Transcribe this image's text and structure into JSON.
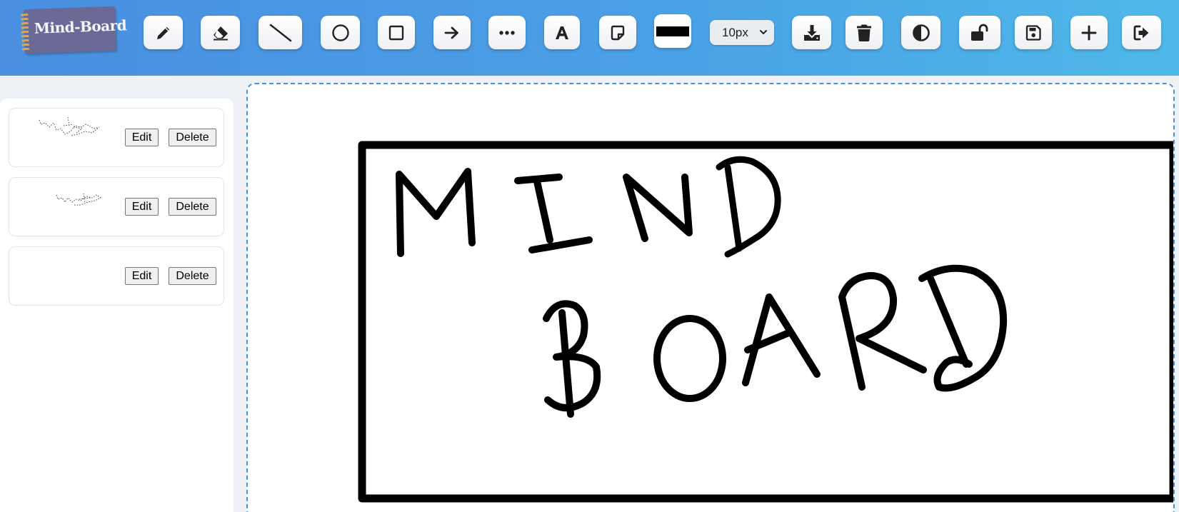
{
  "app": {
    "logo_text": "Mind-Board"
  },
  "toolbar": {
    "tools": [
      {
        "name": "pencil-tool-button",
        "icon": "pencil-icon"
      },
      {
        "name": "eraser-tool-button",
        "icon": "eraser-icon"
      },
      {
        "name": "line-tool-button",
        "icon": "line-icon"
      },
      {
        "name": "circle-tool-button",
        "icon": "circle-icon"
      },
      {
        "name": "rectangle-tool-button",
        "icon": "square-icon"
      },
      {
        "name": "arrow-tool-button",
        "icon": "arrow-right-icon"
      },
      {
        "name": "dotted-line-tool-button",
        "icon": "ellipsis-icon"
      },
      {
        "name": "text-tool-button",
        "icon": "text-icon"
      },
      {
        "name": "sticky-note-tool-button",
        "icon": "sticky-note-icon"
      }
    ],
    "stroke_color": "#000000",
    "stroke_size": "10px",
    "actions": [
      {
        "name": "download-button",
        "icon": "download-icon"
      },
      {
        "name": "clear-board-button",
        "icon": "trash-icon"
      },
      {
        "name": "theme-toggle-button",
        "icon": "contrast-icon"
      },
      {
        "name": "lock-toggle-button",
        "icon": "unlock-icon"
      },
      {
        "name": "save-button",
        "icon": "floppy-disk-icon"
      },
      {
        "name": "new-board-button",
        "icon": "plus-icon"
      },
      {
        "name": "logout-button",
        "icon": "sign-out-icon"
      }
    ]
  },
  "sidebar": {
    "boards": [
      {
        "edit_label": "Edit",
        "delete_label": "Delete",
        "has_thumbnail": true
      },
      {
        "edit_label": "Edit",
        "delete_label": "Delete",
        "has_thumbnail": true
      },
      {
        "edit_label": "Edit",
        "delete_label": "Delete",
        "has_thumbnail": false
      }
    ]
  },
  "colors": {
    "toolbar_gradient_start": "#4a8fe0",
    "toolbar_gradient_end": "#4fb8e8",
    "canvas_border": "#4a90e2",
    "ink": "#000000"
  }
}
